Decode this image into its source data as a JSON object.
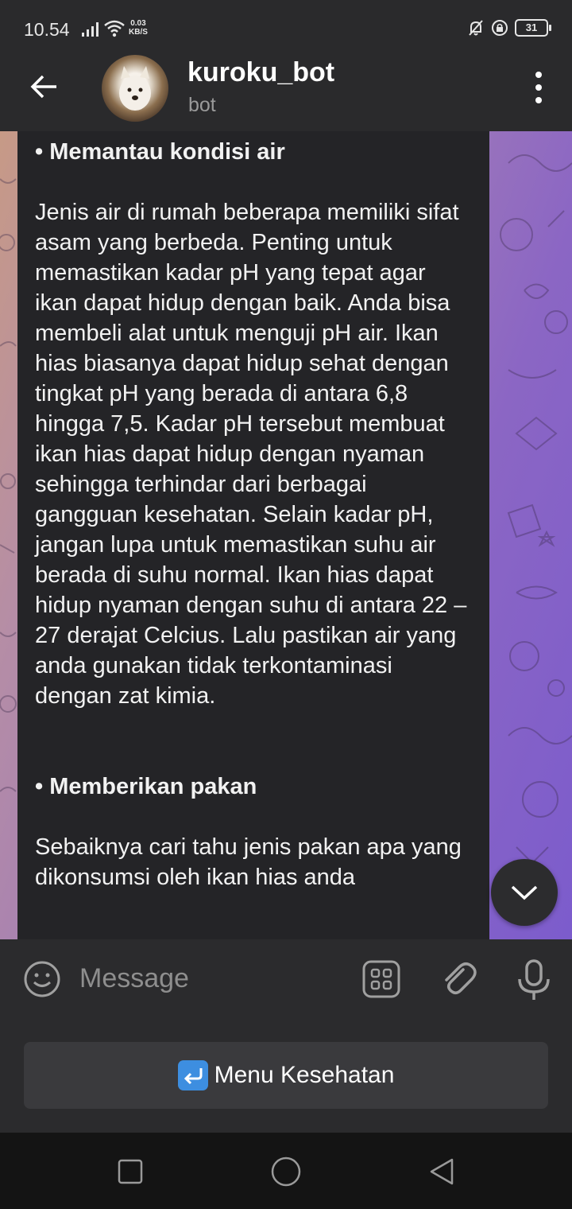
{
  "status_bar": {
    "time": "10.54",
    "net_speed_value": "0.03",
    "net_speed_unit": "KB/S",
    "battery": "31"
  },
  "header": {
    "title": "kuroku_bot",
    "subtitle": "bot"
  },
  "message": {
    "heading1": "• Memantau kondisi air",
    "paragraph1": "Jenis air di rumah beberapa memiliki sifat asam yang berbeda. Penting untuk memastikan kadar pH yang tepat agar ikan dapat hidup dengan baik. Anda bisa membeli alat untuk menguji pH air. Ikan hias biasanya dapat hidup sehat dengan tingkat pH yang berada di antara 6,8 hingga 7,5. Kadar pH tersebut membuat ikan hias dapat hidup dengan nyaman sehingga terhindar dari berbagai gangguan kesehatan. Selain kadar pH, jangan lupa untuk memastikan suhu air berada di suhu normal. Ikan hias dapat hidup nyaman dengan suhu di antara 22 – 27 derajat Celcius. Lalu pastikan air yang anda gunakan tidak terkontaminasi dengan zat kimia.",
    "heading2": "• Memberikan pakan",
    "paragraph2": "Sebaiknya cari tahu jenis pakan apa yang dikonsumsi oleh ikan hias anda"
  },
  "input": {
    "placeholder": "Message"
  },
  "keyboard": {
    "button_emoji": "↩",
    "button_label": "Menu Kesehatan"
  },
  "colors": {
    "bubble_bg": "#242427",
    "accent_blue": "#3d8ee0"
  }
}
